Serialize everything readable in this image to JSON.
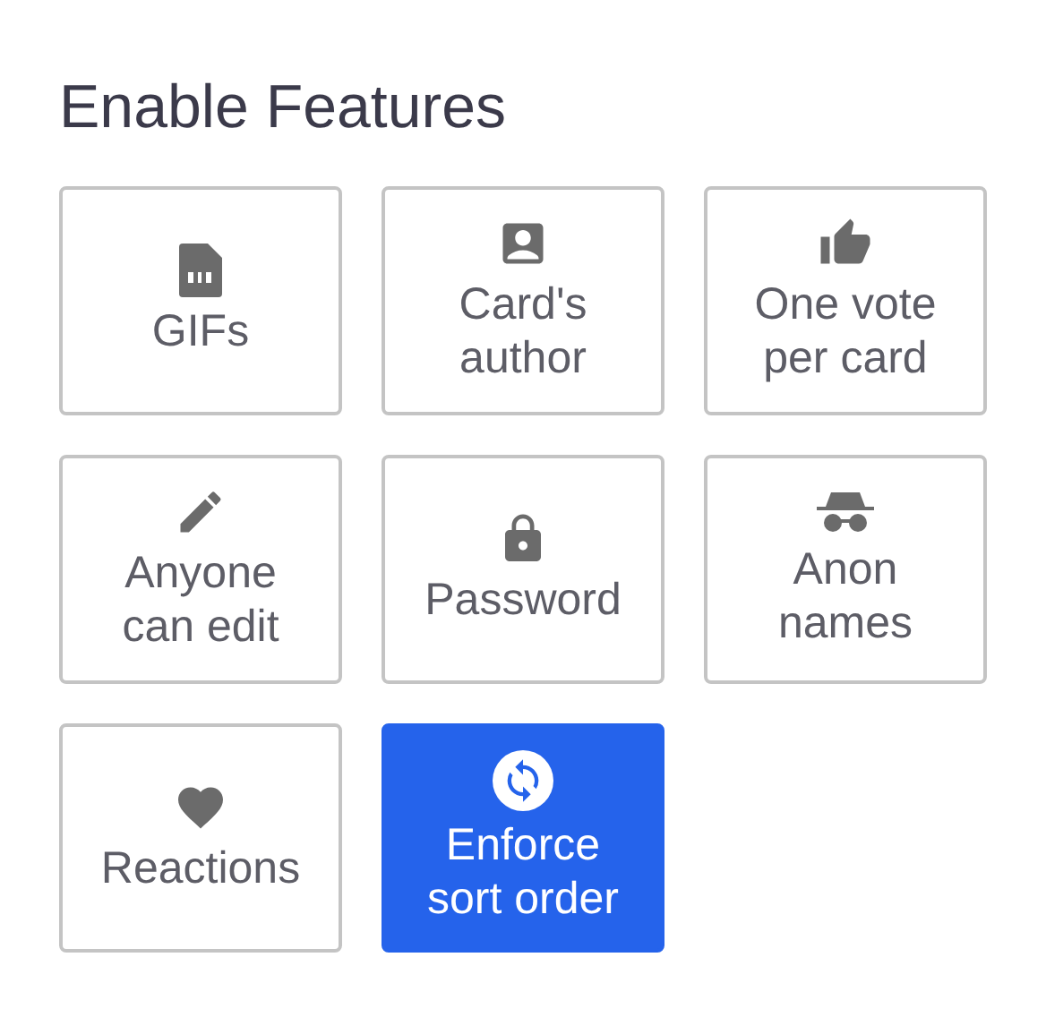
{
  "title": "Enable Features",
  "features": [
    {
      "kind": "gif",
      "lines": [
        "GIFs"
      ],
      "selected": false
    },
    {
      "kind": "author",
      "lines": [
        "Card's",
        "author"
      ],
      "selected": false
    },
    {
      "kind": "vote",
      "lines": [
        "One vote",
        "per card"
      ],
      "selected": false
    },
    {
      "kind": "edit",
      "lines": [
        "Anyone",
        "can edit"
      ],
      "selected": false
    },
    {
      "kind": "lock",
      "lines": [
        "Password"
      ],
      "selected": false
    },
    {
      "kind": "anon",
      "lines": [
        "Anon",
        "names"
      ],
      "selected": false
    },
    {
      "kind": "heart",
      "lines": [
        "Reactions"
      ],
      "selected": false
    },
    {
      "kind": "sort",
      "lines": [
        "Enforce",
        "sort order"
      ],
      "selected": true
    }
  ]
}
